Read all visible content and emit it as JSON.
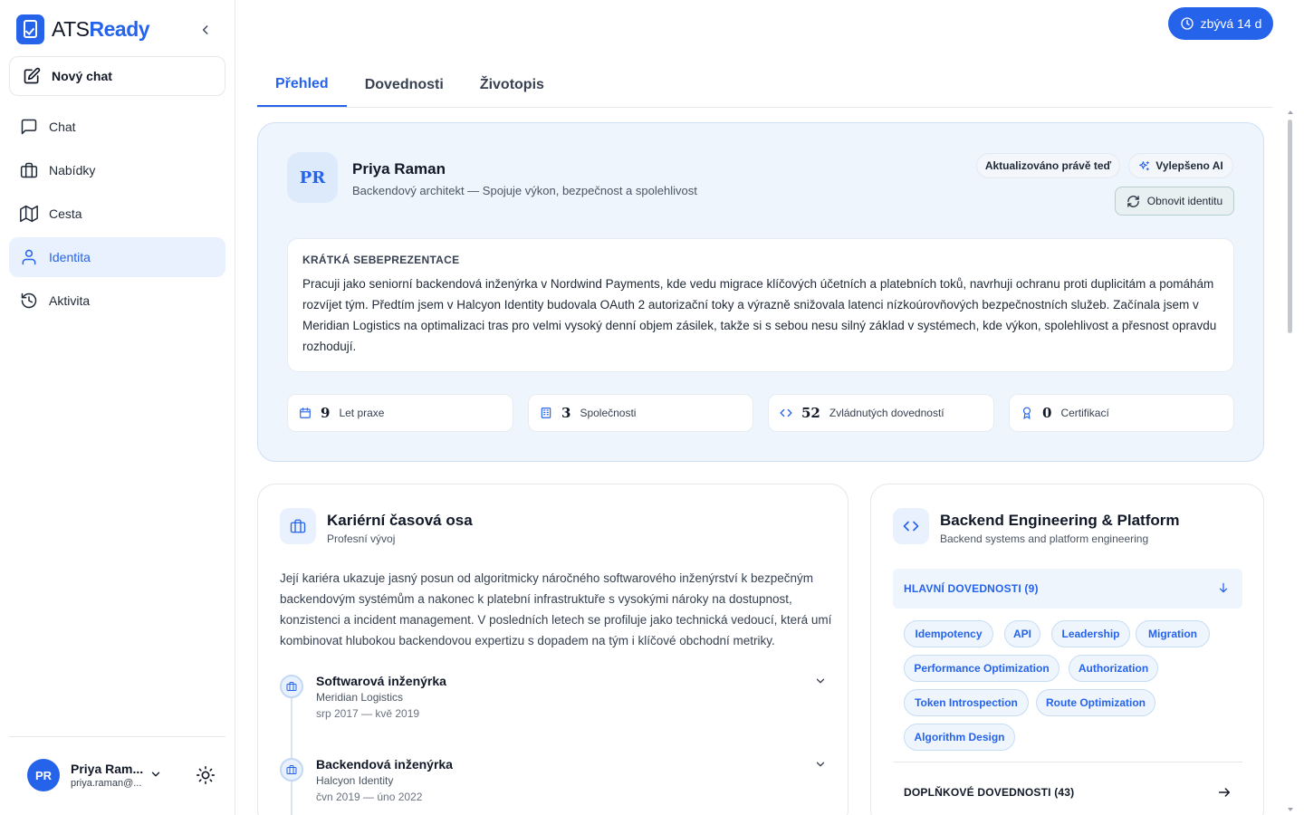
{
  "brand": {
    "name_part1": "ATS",
    "name_part2": "Ready"
  },
  "sidebar": {
    "new_chat_label": "Nový chat",
    "items": [
      {
        "label": "Chat",
        "icon": "chat-icon"
      },
      {
        "label": "Nabídky",
        "icon": "briefcase-icon"
      },
      {
        "label": "Cesta",
        "icon": "map-icon"
      },
      {
        "label": "Identita",
        "icon": "user-icon",
        "active": true
      },
      {
        "label": "Aktivita",
        "icon": "history-icon"
      }
    ],
    "user": {
      "initials": "PR",
      "name": "Priya Ram...",
      "email": "priya.raman@..."
    }
  },
  "trial_badge": {
    "label": "zbývá 14 d",
    "icon": "clock-icon"
  },
  "tabs": [
    {
      "label": "Přehled",
      "active": true
    },
    {
      "label": "Dovednosti"
    },
    {
      "label": "Životopis"
    }
  ],
  "profile": {
    "initials": "PR",
    "name": "Priya Raman",
    "headline": "Backendový architekt — Spojuje výkon, bezpečnost a spolehlivost",
    "updated_label": "Aktualizováno právě teď",
    "ai_label": "Vylepšeno AI",
    "refresh_label": "Obnovit identitu",
    "bio_title": "KRÁTKÁ SEBEPREZENTACE",
    "bio_text": "Pracuji jako seniorní backendová inženýrka v Nordwind Payments, kde vedu migrace klíčových účetních a platebních toků, navrhuji ochranu proti duplicitám a pomáhám rozvíjet tým. Předtím jsem v Halcyon Identity budovala OAuth 2 autorizační toky a výrazně snižovala latenci nízkoúrovňových bezpečnostních služeb. Začínala jsem v Meridian Logistics na optimalizaci tras pro velmi vysoký denní objem zásilek, takže si s sebou nesu silný základ v systémech, kde výkon, spolehlivost a přesnost opravdu rozhodují.",
    "stats": [
      {
        "value": "9",
        "label": "Let praxe",
        "icon": "calendar-icon"
      },
      {
        "value": "3",
        "label": "Společnosti",
        "icon": "building-icon"
      },
      {
        "value": "52",
        "label": "Zvládnutých dovedností",
        "icon": "code-icon"
      },
      {
        "value": "0",
        "label": "Certifikací",
        "icon": "award-icon"
      }
    ]
  },
  "career": {
    "title": "Kariérní časová osa",
    "subtitle": "Profesní vývoj",
    "summary": "Její kariéra ukazuje jasný posun od algoritmicky náročného softwarového inženýrství k bezpečným backendovým systémům a nakonec k platební infrastruktuře s vysokými nároky na dostupnost, konzistenci a incident management. V posledních letech se profiluje jako technická vedoucí, která umí kombinovat hlubokou backendovou expertizu s dopadem na tým i klíčové obchodní metriky.",
    "entries": [
      {
        "role": "Softwarová inženýrka",
        "company": "Meridian Logistics",
        "dates": "srp 2017 — kvě 2019"
      },
      {
        "role": "Backendová inženýrka",
        "company": "Halcyon Identity",
        "dates": "čvn 2019 — úno 2022"
      }
    ]
  },
  "skills": {
    "title": "Backend Engineering & Platform",
    "subtitle": "Backend systems and platform engineering",
    "main_label": "HLAVNÍ DOVEDNOSTI (9)",
    "tags": [
      "Idempotency",
      "API",
      "Leadership",
      "Migration",
      "Performance Optimization",
      "Authorization",
      "Token Introspection",
      "Route Optimization",
      "Algorithm Design"
    ],
    "extra_label": "DOPLŇKOVÉ DOVEDNOSTI (43)"
  }
}
